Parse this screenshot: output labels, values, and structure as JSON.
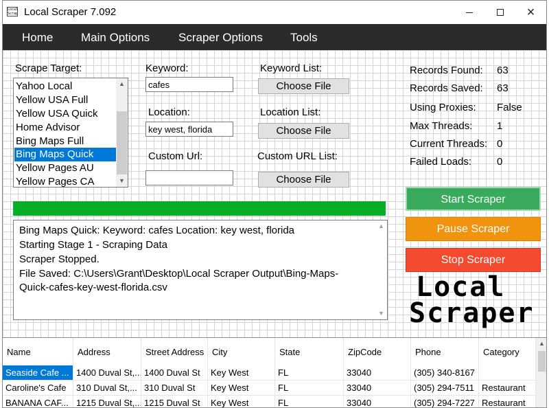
{
  "window": {
    "title": "Local Scraper 7.092",
    "icon_text": "Local Scraper",
    "controls": {
      "minimize": "minimize-icon",
      "maximize": "maximize-icon",
      "close": "×"
    }
  },
  "menu": [
    "Home",
    "Main Options",
    "Scraper Options",
    "Tools"
  ],
  "scrape_target": {
    "label": "Scrape Target:",
    "items": [
      "Yahoo Local",
      "Yellow USA Full",
      "Yellow USA Quick",
      "Home Advisor",
      "Bing Maps Full",
      "Bing Maps Quick",
      "Yellow Pages AU",
      "Yellow Pages CA"
    ],
    "selected": "Bing Maps Quick"
  },
  "inputs": {
    "keyword": {
      "label": "Keyword:",
      "value": "cafes"
    },
    "location": {
      "label": "Location:",
      "value": "key west, florida"
    },
    "custom_url": {
      "label": "Custom Url:",
      "value": ""
    }
  },
  "file_pickers": {
    "keyword_list": {
      "label": "Keyword List:",
      "button": "Choose File"
    },
    "location_list": {
      "label": "Location List:",
      "button": "Choose File"
    },
    "custom_url_list": {
      "label": "Custom URL List:",
      "button": "Choose File"
    }
  },
  "stats": [
    {
      "label": "Records Found:",
      "value": "63"
    },
    {
      "label": "Records Saved:",
      "value": "63"
    },
    {
      "label": "Using Proxies:",
      "value": "False"
    },
    {
      "label": "Max Threads:",
      "value": "1"
    },
    {
      "label": "Current Threads:",
      "value": "0"
    },
    {
      "label": "Failed Loads:",
      "value": "0"
    }
  ],
  "progress": {
    "fraction": 1.0,
    "color": "#06b025"
  },
  "log": {
    "lines": [
      "Bing Maps Quick: Keyword: cafes Location: key west, florida",
      "Starting Stage 1 - Scraping Data",
      "Scraper Stopped.",
      "File Saved: C:\\Users\\Grant\\Desktop\\Local Scraper Output\\Bing-Maps-",
      "Quick-cafes-key-west-florida.csv"
    ]
  },
  "actions": {
    "start": {
      "label": "Start Scraper",
      "color": "#3aaa5c"
    },
    "pause": {
      "label": "Pause Scraper",
      "color": "#f0930f"
    },
    "stop": {
      "label": "Stop Scraper",
      "color": "#f44b30"
    }
  },
  "logo": {
    "line1": "Local",
    "line2": "Scraper"
  },
  "table": {
    "columns": [
      "Name",
      "Address",
      "Street Address",
      "City",
      "State",
      "ZipCode",
      "Phone",
      "Category"
    ],
    "rows": [
      [
        "Seaside Cafe ...",
        "1400 Duval St,...",
        "1400 Duval St",
        "Key West",
        "FL",
        "33040",
        "(305) 340-8167",
        ""
      ],
      [
        "Caroline's Cafe",
        "310 Duval St,...",
        "310 Duval St",
        "Key West",
        "FL",
        "33040",
        "(305) 294-7511",
        "Restaurant"
      ],
      [
        "BANANA CAF...",
        "1215 Duval St,...",
        "1215 Duval St",
        "Key West",
        "FL",
        "33040",
        "(305) 294-7227",
        "Restaurant"
      ]
    ]
  }
}
